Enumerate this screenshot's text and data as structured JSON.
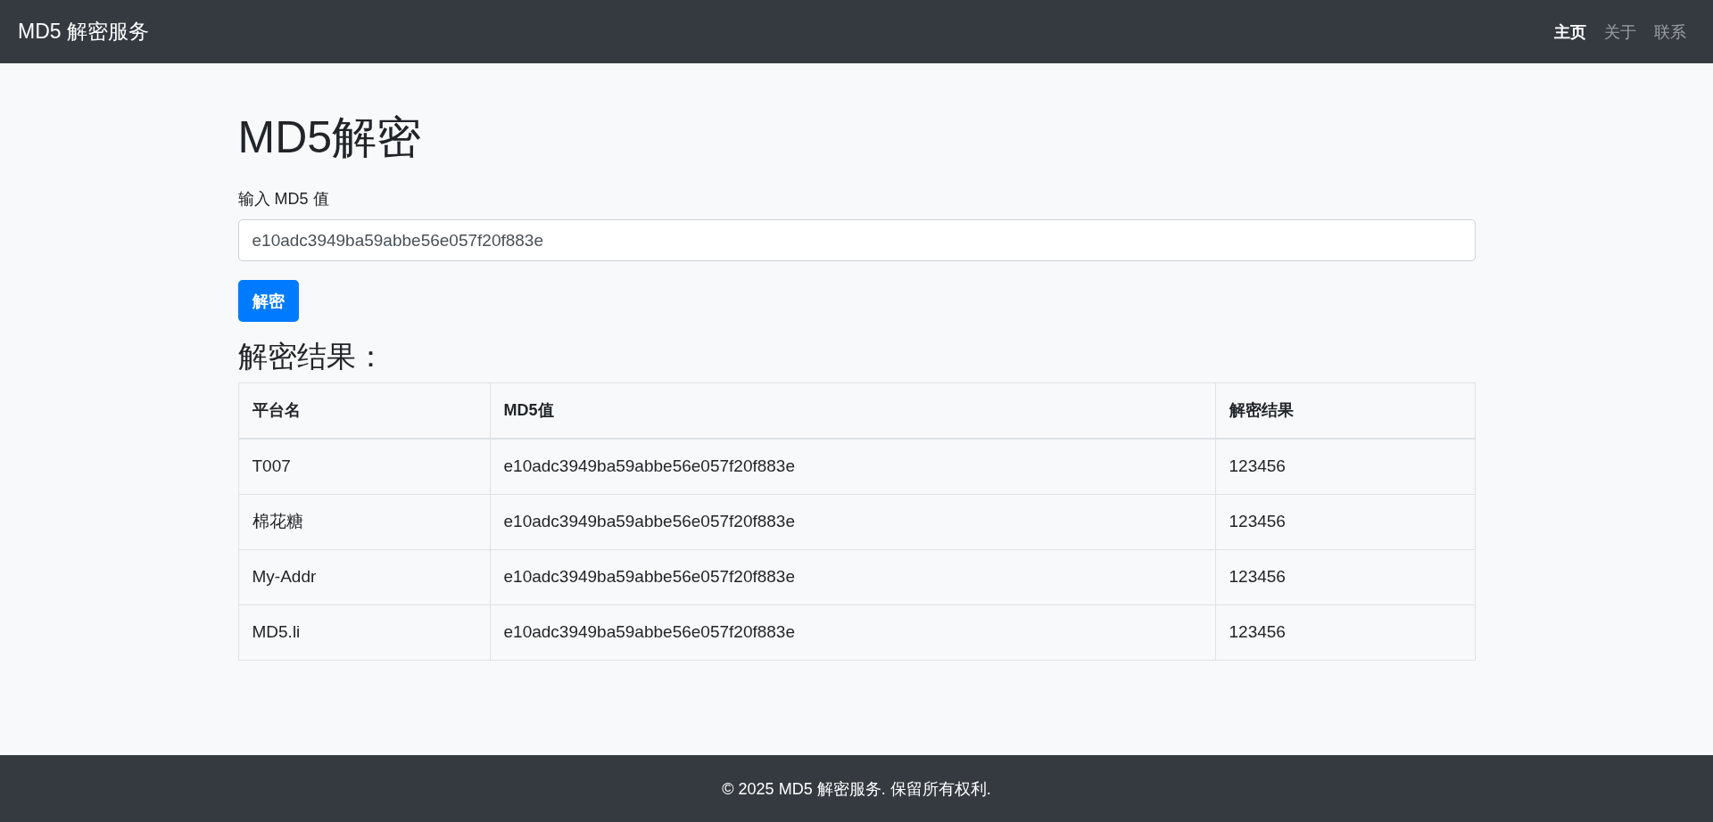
{
  "navbar": {
    "brand": "MD5 解密服务",
    "links": [
      {
        "label": "主页",
        "selected": true
      },
      {
        "label": "关于",
        "selected": false
      },
      {
        "label": "联系",
        "selected": false
      }
    ]
  },
  "heading": "MD5解密",
  "form": {
    "label": "输入 MD5 值",
    "input_value": "e10adc3949ba59abbe56e057f20f883e",
    "button": "解密"
  },
  "results": {
    "title": "解密结果：",
    "table": {
      "columns": [
        "平台名",
        "MD5值",
        "解密结果"
      ],
      "rows": [
        [
          "T007",
          "e10adc3949ba59abbe56e057f20f883e",
          "123456"
        ],
        [
          "棉花糖",
          "e10adc3949ba59abbe56e057f20f883e",
          "123456"
        ],
        [
          "My-Addr",
          "e10adc3949ba59abbe56e057f20f883e",
          "123456"
        ],
        [
          "MD5.li",
          "e10adc3949ba59abbe56e057f20f883e",
          "123456"
        ]
      ]
    }
  },
  "footer": "© 2025 MD5 解密服务. 保留所有权利."
}
